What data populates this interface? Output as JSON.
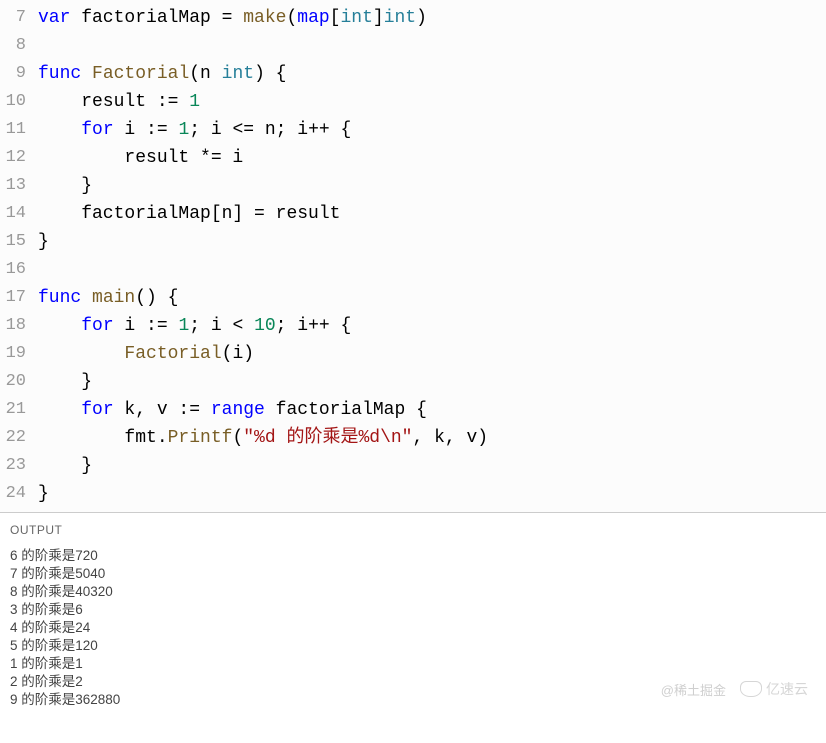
{
  "code": {
    "lines": [
      {
        "n": 7,
        "html": "<span class='kw'>var</span> factorialMap = <span class='fn'>make</span>(<span class='kw'>map</span>[<span class='type'>int</span>]<span class='type'>int</span>)"
      },
      {
        "n": 8,
        "html": ""
      },
      {
        "n": 9,
        "html": "<span class='kw'>func</span> <span class='fn'>Factorial</span>(n <span class='type'>int</span>) {"
      },
      {
        "n": 10,
        "html": "    result := <span class='num'>1</span>"
      },
      {
        "n": 11,
        "html": "    <span class='kw'>for</span> i := <span class='num'>1</span>; i &lt;= n; i++ {"
      },
      {
        "n": 12,
        "html": "        result *= i"
      },
      {
        "n": 13,
        "html": "    }"
      },
      {
        "n": 14,
        "html": "    factorialMap[n] = result"
      },
      {
        "n": 15,
        "html": "}"
      },
      {
        "n": 16,
        "html": ""
      },
      {
        "n": 17,
        "html": "<span class='kw'>func</span> <span class='fn'>main</span>() {"
      },
      {
        "n": 18,
        "html": "    <span class='kw'>for</span> i := <span class='num'>1</span>; i &lt; <span class='num'>10</span>; i++ {"
      },
      {
        "n": 19,
        "html": "        <span class='fn'>Factorial</span>(i)"
      },
      {
        "n": 20,
        "html": "    }"
      },
      {
        "n": 21,
        "html": "    <span class='kw'>for</span> k, v := <span class='kw'>range</span> factorialMap {"
      },
      {
        "n": 22,
        "html": "        fmt.<span class='fn'>Printf</span>(<span class='str'>\"%d </span><span class='cjk'>的阶乘是</span><span class='str'>%d\\n\"</span>, k, v)"
      },
      {
        "n": 23,
        "html": "    }"
      },
      {
        "n": 24,
        "html": "}"
      }
    ]
  },
  "output": {
    "label": "OUTPUT",
    "lines": [
      "6 的阶乘是720",
      "7 的阶乘是5040",
      "8 的阶乘是40320",
      "3 的阶乘是6",
      "4 的阶乘是24",
      "5 的阶乘是120",
      "1 的阶乘是1",
      "2 的阶乘是2",
      "9 的阶乘是362880"
    ]
  },
  "watermark": {
    "text1": "@稀土掘金",
    "text2": "亿速云"
  }
}
